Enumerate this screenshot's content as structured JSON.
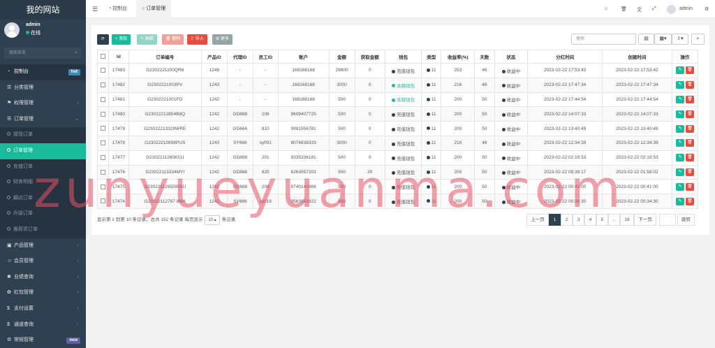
{
  "brand": "我的网站",
  "user": {
    "name": "admin",
    "status": "在线"
  },
  "sidebar_search_placeholder": "搜索菜单",
  "menu": [
    {
      "label": "控制台",
      "icon": "dashboard-icon",
      "badge": "hot",
      "badge_color": "#3c8dbc"
    },
    {
      "label": "分类管理",
      "icon": "list-icon"
    },
    {
      "label": "权限管理",
      "icon": "group-icon",
      "arrow": "‹"
    },
    {
      "label": "订单管理",
      "icon": "list-icon",
      "arrow": "⌄"
    }
  ],
  "submenu": [
    {
      "label": "提现订单"
    },
    {
      "label": "订单管理",
      "active": true
    },
    {
      "label": "充值订单"
    },
    {
      "label": "财务明细"
    },
    {
      "label": "翻达订单"
    },
    {
      "label": "升级订单"
    },
    {
      "label": "推荐奖订单"
    }
  ],
  "menu_bottom": [
    {
      "label": "产品管理",
      "icon": "box-icon",
      "arrow": "‹"
    },
    {
      "label": "会员管理",
      "icon": "user-icon",
      "arrow": "‹"
    },
    {
      "label": "业绩查询",
      "icon": "gear-icon",
      "arrow": "‹"
    },
    {
      "label": "红包管理",
      "icon": "gift-icon",
      "arrow": "‹"
    },
    {
      "label": "支付设置",
      "icon": "dollar-icon",
      "arrow": "‹"
    },
    {
      "label": "通道查询",
      "icon": "dollar-icon",
      "arrow": "‹"
    },
    {
      "label": "常规管理",
      "icon": "cog-icon",
      "badge": "new",
      "badge_color": "#605ca8"
    }
  ],
  "topbar": {
    "tab1": "控制台",
    "tab2": "订单管理",
    "username": "admin"
  },
  "toolbar": {
    "refresh": "⟳",
    "add": "+ 添加",
    "edit": "✎ 编辑",
    "delete": "🗑 删除",
    "import": "⇪ 导入",
    "more": "⚙ 更多",
    "search_placeholder": "搜索"
  },
  "columns": [
    "Id",
    "订单编号",
    "产品ID",
    "代理ID",
    "员工ID",
    "账户",
    "金额",
    "获取金额",
    "钱包",
    "类型",
    "收益率(%)",
    "天数",
    "状态",
    "分红时间",
    "创建时间",
    "操作"
  ],
  "rows": [
    {
      "id": "17483",
      "no": "G2302221100QR6",
      "pid": "1246",
      "agent": "-",
      "staff": "-",
      "account": "168168168",
      "amount": "29800",
      "gain": "0",
      "wallet": "充值钱包",
      "wallet_color": "#2f4050",
      "type": "11",
      "rate": "253",
      "days": "46",
      "status": "收益中",
      "bonus_time": "2023-02-22 17:53:42",
      "created": "2023-02-22 17:53:42"
    },
    {
      "id": "17482",
      "no": "G2302221003PV",
      "pid": "1243",
      "agent": "-",
      "staff": "-",
      "account": "168168168",
      "amount": "3000",
      "gain": "0",
      "wallet": "余额钱包",
      "wallet_color": "#18bc9c",
      "type": "11",
      "rate": "216",
      "days": "48",
      "status": "收益中",
      "bonus_time": "2023-02-22 17:47:34",
      "created": "2023-02-22 17:47:34"
    },
    {
      "id": "17481",
      "no": "G2302221001FO",
      "pid": "1242",
      "agent": "-",
      "staff": "-",
      "account": "168168168",
      "amount": "500",
      "gain": "0",
      "wallet": "余额钱包",
      "wallet_color": "#18bc9c",
      "type": "11",
      "rate": "200",
      "days": "50",
      "status": "收益中",
      "bonus_time": "2023-02-22 17:44:54",
      "created": "2023-02-22 17:44:54"
    },
    {
      "id": "17480",
      "no": "G23022212854B8Q",
      "pid": "1242",
      "agent": "GD888",
      "staff": "206",
      "account": "9609407725",
      "amount": "500",
      "gain": "0",
      "wallet": "充值钱包",
      "wallet_color": "#2f4050",
      "type": "11",
      "rate": "200",
      "days": "50",
      "status": "收益中",
      "bonus_time": "2023-02-22 14:07:33",
      "created": "2023-02-22 14:07:33"
    },
    {
      "id": "17479",
      "no": "G23022213329WRE",
      "pid": "1242",
      "agent": "GD666",
      "staff": "810",
      "account": "9991956781",
      "amount": "500",
      "gain": "0",
      "wallet": "充值钱包",
      "wallet_color": "#2f4050",
      "type": "11",
      "rate": "200",
      "days": "50",
      "status": "收益中",
      "bonus_time": "2023-02-22 13:40:49",
      "created": "2023-02-22 13:40:49"
    },
    {
      "id": "17478",
      "no": "G23022210898PUS",
      "pid": "1243",
      "agent": "SY666",
      "staff": "sy001",
      "account": "8074838333",
      "amount": "3000",
      "gain": "0",
      "wallet": "充值钱包",
      "wallet_color": "#2f4050",
      "type": "11",
      "rate": "216",
      "days": "48",
      "status": "收益中",
      "bonus_time": "2023-02-22 12:34:39",
      "created": "2023-02-22 12:34:39"
    },
    {
      "id": "17477",
      "no": "G23022112606S1I",
      "pid": "1242",
      "agent": "GD888",
      "staff": "201",
      "account": "9335336181",
      "amount": "500",
      "gain": "0",
      "wallet": "充值钱包",
      "wallet_color": "#2f4050",
      "type": "11",
      "rate": "200",
      "days": "50",
      "status": "收益中",
      "bonus_time": "2023-02-22 02:19:53",
      "created": "2023-02-22 02:19:53"
    },
    {
      "id": "17476",
      "no": "G23022113334MYI",
      "pid": "1242",
      "agent": "GD888",
      "staff": "825",
      "account": "6263057203",
      "amount": "500",
      "gain": "20",
      "wallet": "充值钱包",
      "wallet_color": "#2f4050",
      "type": "11",
      "rate": "200",
      "days": "50",
      "status": "收益中",
      "bonus_time": "2023-02-22 09:39:17",
      "created": "2023-02-22 01:58:02"
    },
    {
      "id": "17475",
      "no": "G23022112955956U",
      "pid": "1242",
      "agent": "GD888",
      "staff": "208",
      "account": "9740141868",
      "amount": "500",
      "gain": "0",
      "wallet": "充值钱包",
      "wallet_color": "#2f4050",
      "type": "11",
      "rate": "200",
      "days": "50",
      "status": "收益中",
      "bonus_time": "2023-02-22 00:41:00",
      "created": "2023-02-22 00:41:00"
    },
    {
      "id": "17474",
      "no": "G23022112767 8MX",
      "pid": "1242",
      "agent": "SY666",
      "staff": "sy019",
      "account": "9563841822",
      "amount": "500",
      "gain": "0",
      "wallet": "充值钱包",
      "wallet_color": "#2f4050",
      "type": "11",
      "rate": "200",
      "days": "50",
      "status": "收益中",
      "bonus_time": "2023-02-22 00:34:30",
      "created": "2023-02-22 00:34:30"
    }
  ],
  "pagination": {
    "info_prefix": "显示第 1 到第 10 条记录，总共 152 条记录 每页显示",
    "page_size": "10 ▴",
    "info_suffix": "条记录",
    "prev": "上一页",
    "pages": [
      "1",
      "2",
      "3",
      "4",
      "5",
      "...",
      "16"
    ],
    "next": "下一页",
    "jump": "跳转"
  },
  "watermark": "zunyueyuanma.com",
  "colors": {
    "sidebar": "#2f4050",
    "accent": "#18bc9c",
    "danger": "#e74c3c",
    "edit": "#1abc9c",
    "import": "#e74c3c"
  }
}
